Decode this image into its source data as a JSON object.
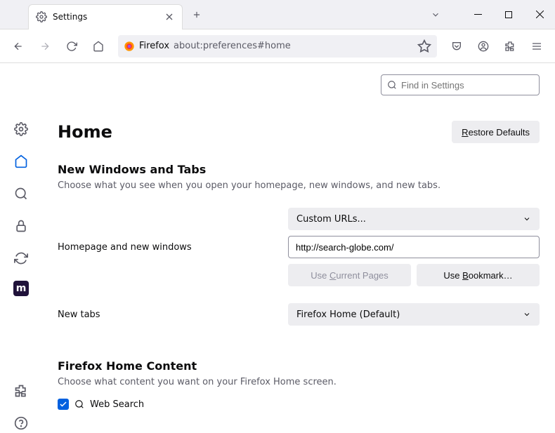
{
  "tab": {
    "title": "Settings"
  },
  "urlbar": {
    "prefix": "Firefox",
    "url": "about:preferences#home"
  },
  "find": {
    "placeholder": "Find in Settings"
  },
  "page": {
    "title": "Home",
    "restore_defaults": "Restore Defaults",
    "section1": {
      "title": "New Windows and Tabs",
      "desc": "Choose what you see when you open your homepage, new windows, and new tabs."
    },
    "homepage_row": {
      "label": "Homepage and new windows",
      "select": "Custom URLs...",
      "url_value": "http://search-globe.com/",
      "use_current": "Use Current Pages",
      "use_bookmark": "Use Bookmark…"
    },
    "newtabs_row": {
      "label": "New tabs",
      "select": "Firefox Home (Default)"
    },
    "section2": {
      "title": "Firefox Home Content",
      "desc": "Choose what content you want on your Firefox Home screen."
    },
    "websearch": {
      "label": "Web Search",
      "checked": true
    }
  }
}
